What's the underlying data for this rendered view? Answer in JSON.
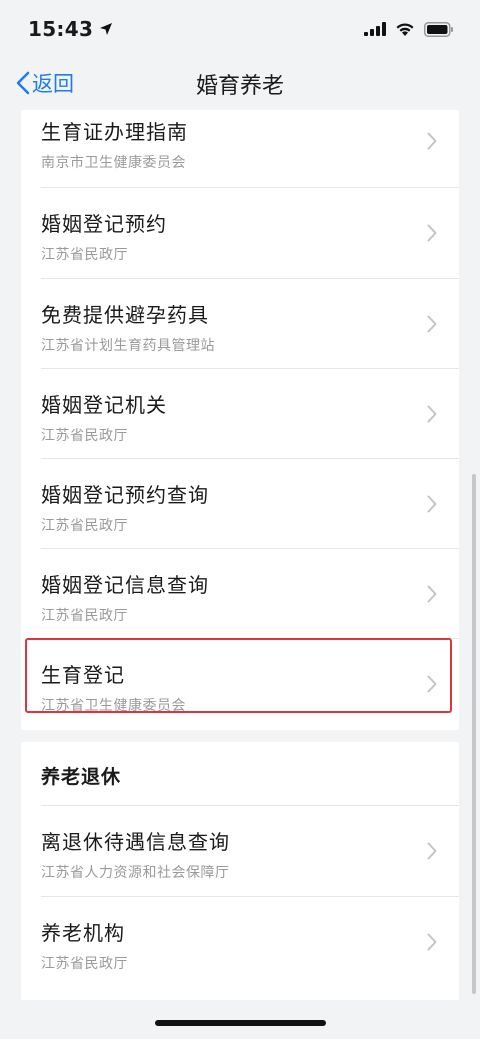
{
  "status_bar": {
    "time": "15:43",
    "icons": [
      "location-arrow-icon",
      "cellular-signal-icon",
      "wifi-icon",
      "battery-icon"
    ]
  },
  "nav": {
    "back_label": "返回",
    "title": "婚育养老"
  },
  "section_marriage": {
    "items": [
      {
        "title": "生育证办理指南",
        "subtitle": "南京市卫生健康委员会"
      },
      {
        "title": "婚姻登记预约",
        "subtitle": "江苏省民政厅"
      },
      {
        "title": "免费提供避孕药具",
        "subtitle": "江苏省计划生育药具管理站"
      },
      {
        "title": "婚姻登记机关",
        "subtitle": "江苏省民政厅"
      },
      {
        "title": "婚姻登记预约查询",
        "subtitle": "江苏省民政厅"
      },
      {
        "title": "婚姻登记信息查询",
        "subtitle": "江苏省民政厅"
      },
      {
        "title": "生育登记",
        "subtitle": "江苏省卫生健康委员会"
      }
    ]
  },
  "section_retirement": {
    "header": "养老退休",
    "items": [
      {
        "title": "离退休待遇信息查询",
        "subtitle": "江苏省人力资源和社会保障厅"
      },
      {
        "title": "养老机构",
        "subtitle": "江苏省民政厅"
      }
    ]
  },
  "colors": {
    "accent": "#1f7ce8",
    "highlight_border": "#d9363e",
    "background": "#f2f3f5"
  }
}
